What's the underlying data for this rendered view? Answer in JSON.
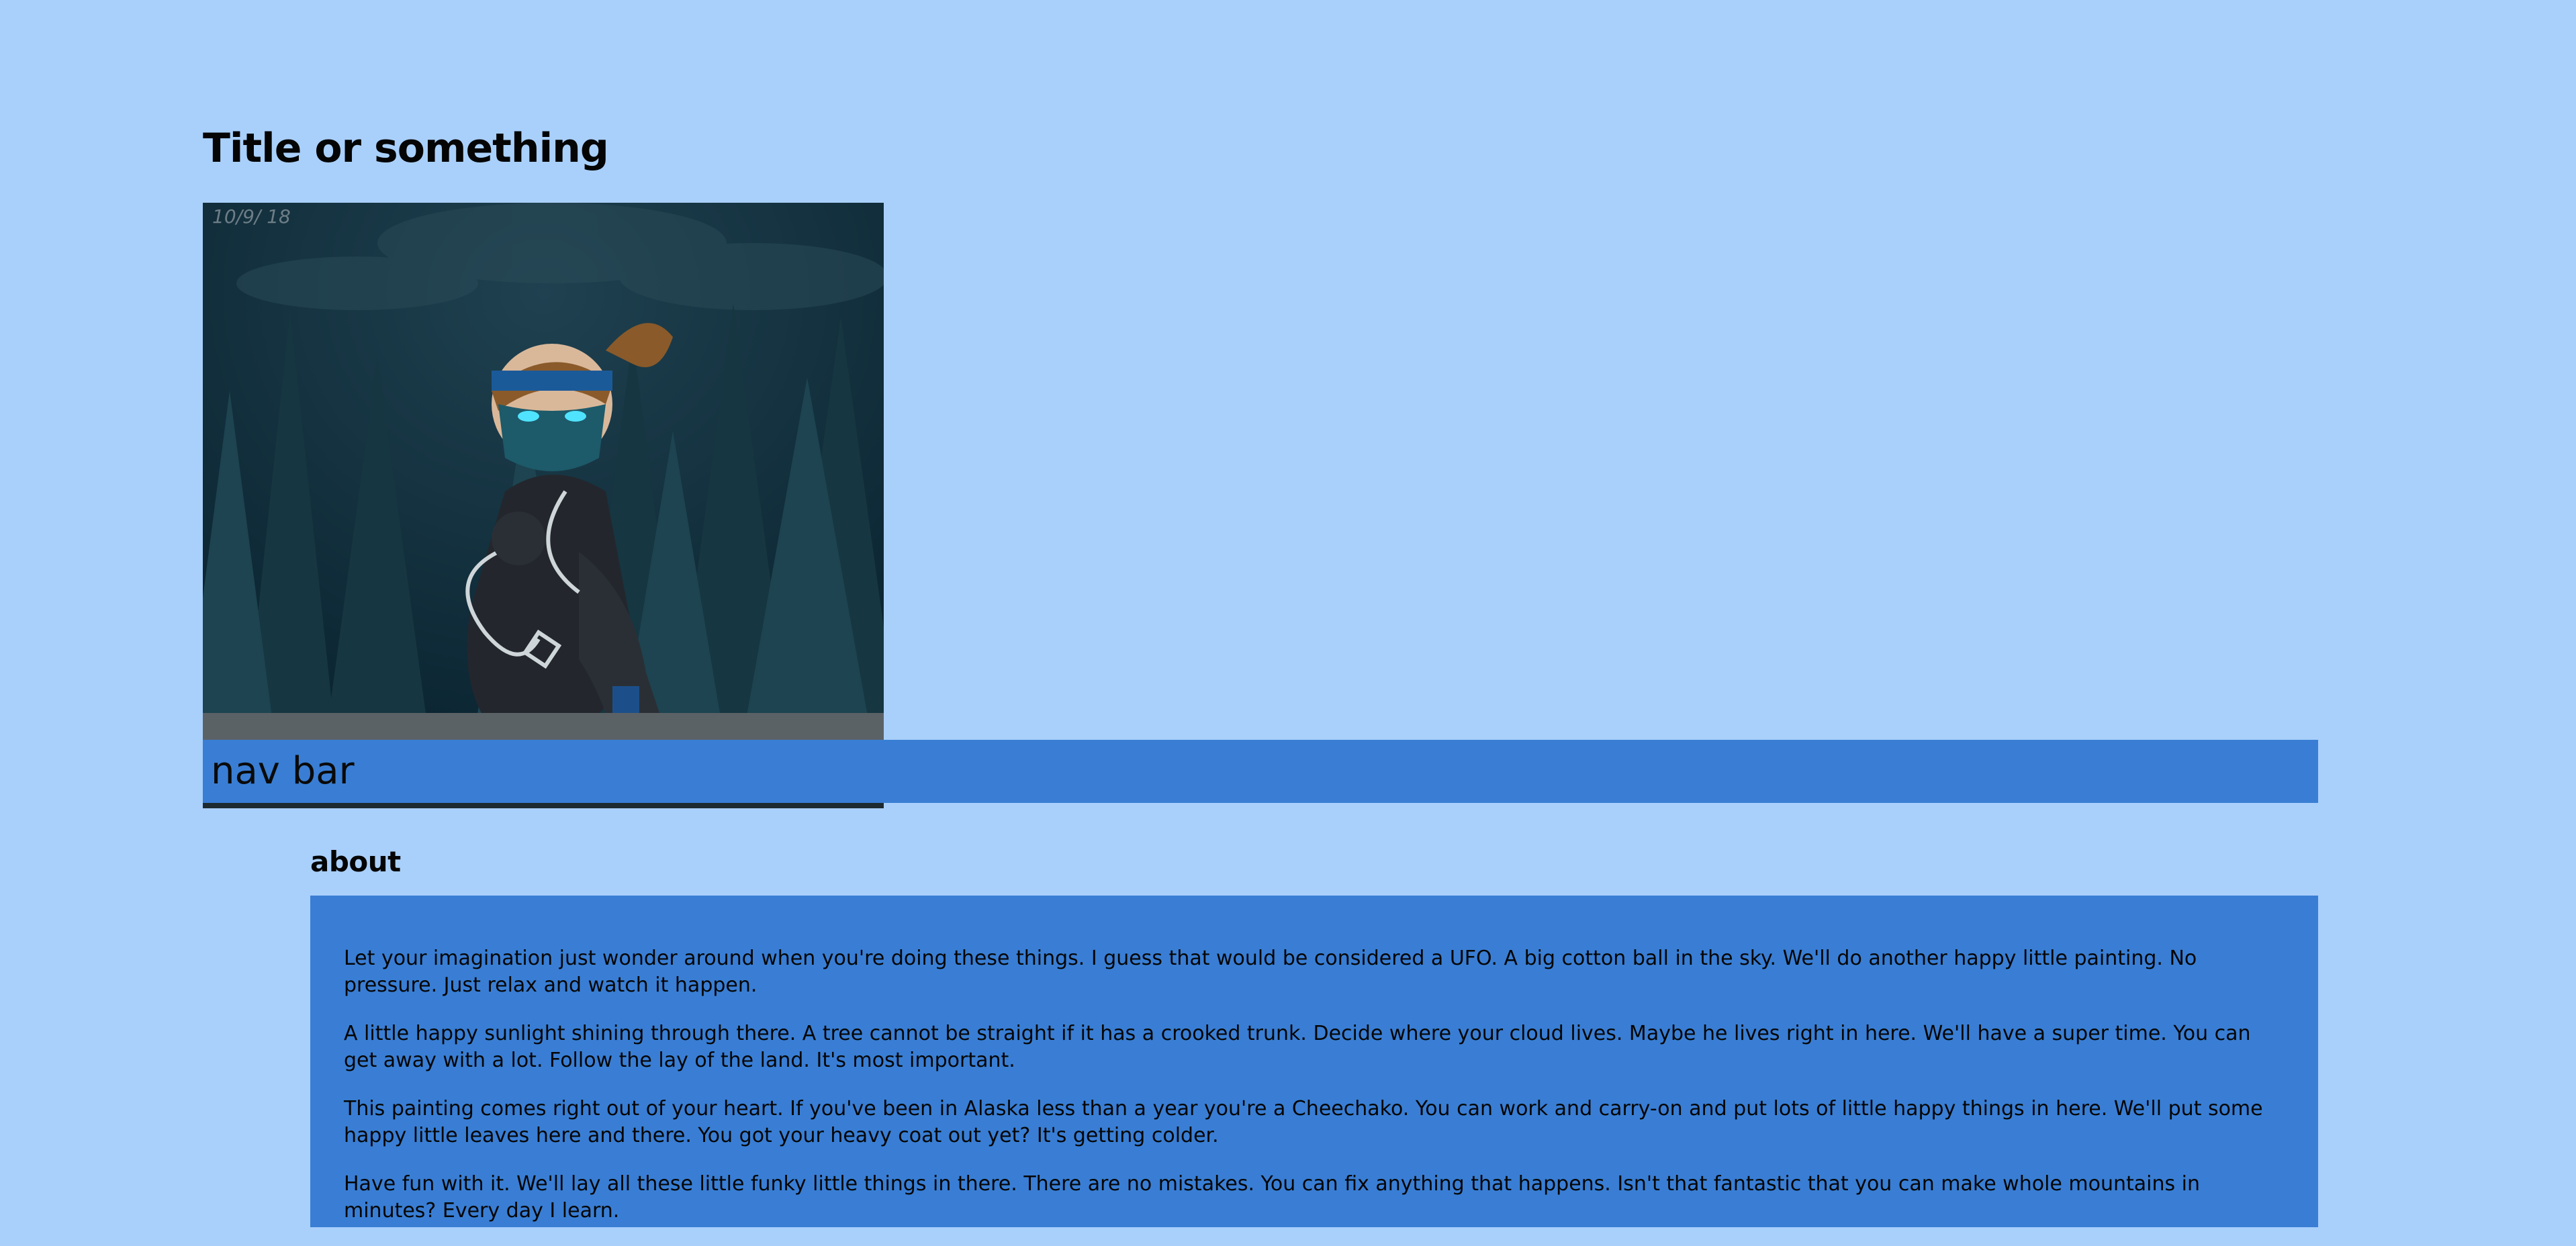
{
  "page": {
    "title": "Title or something",
    "background_color": "#a9d0fb",
    "accent_color": "#397ed4"
  },
  "hero_image": {
    "date_stamp": "10/9/ 18",
    "alt": "hero-artwork",
    "subject_icon": "ninja-character-illustration"
  },
  "navbar": {
    "label": "nav bar"
  },
  "about": {
    "heading": "about",
    "paragraphs": [
      "Let your imagination just wonder around when you're doing these things. I guess that would be considered a UFO. A big cotton ball in the sky. We'll do another happy little painting. No pressure. Just relax and watch it happen.",
      "A little happy sunlight shining through there. A tree cannot be straight if it has a crooked trunk. Decide where your cloud lives. Maybe he lives right in here. We'll have a super time. You can get away with a lot. Follow the lay of the land. It's most important.",
      "This painting comes right out of your heart. If you've been in Alaska less than a year you're a Cheechako. You can work and carry-on and put lots of little happy things in here. We'll put some happy little leaves here and there. You got your heavy coat out yet? It's getting colder.",
      "Have fun with it. We'll lay all these little funky little things in there. There are no mistakes. You can fix anything that happens. Isn't that fantastic that you can make whole mountains in minutes? Every day I learn."
    ]
  }
}
